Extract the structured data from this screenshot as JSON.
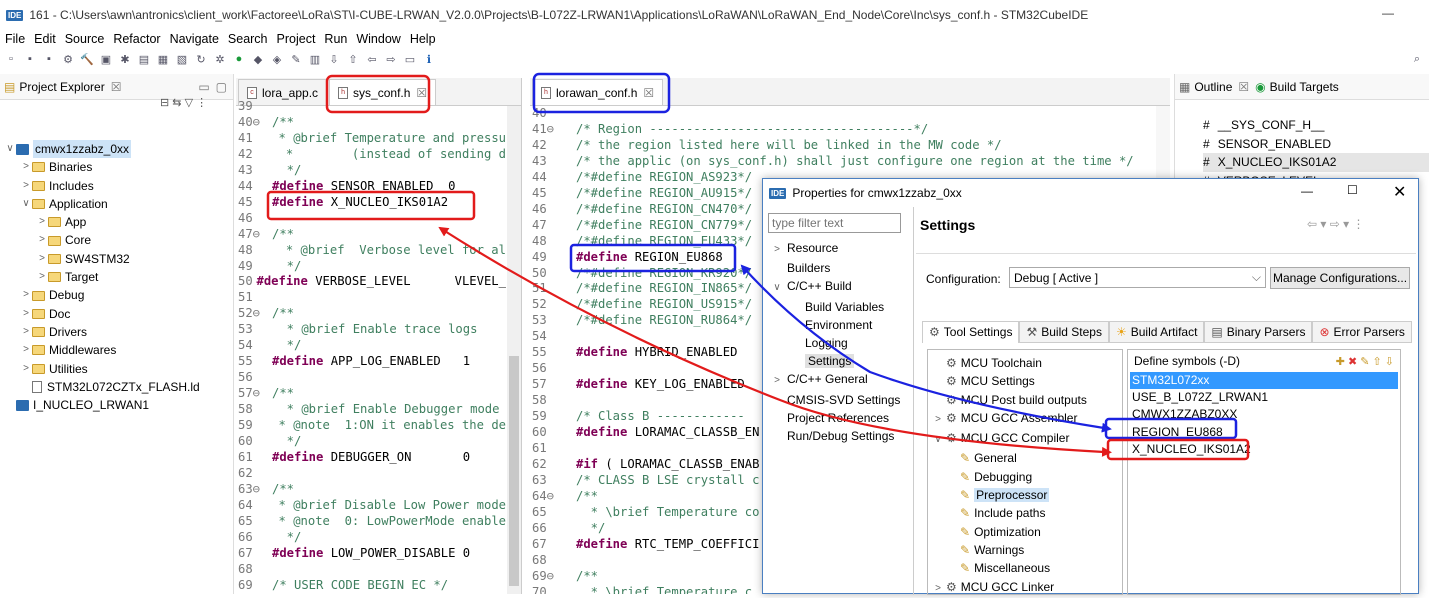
{
  "title": {
    "badge": "IDE",
    "text": "161 - C:\\Users\\awn\\antronics\\client_work\\Factoree\\LoRa\\ST\\I-CUBE-LRWAN_V2.0.0\\Projects\\B-L072Z-LRWAN1\\Applications\\LoRaWAN\\LoRaWAN_End_Node\\Core\\Inc\\sys_conf.h - STM32CubeIDE",
    "min": "—"
  },
  "menu": [
    "File",
    "Edit",
    "Source",
    "Refactor",
    "Navigate",
    "Search",
    "Project",
    "Run",
    "Window",
    "Help"
  ],
  "explorer": {
    "title": "Project Explorer",
    "items": [
      {
        "label": "cmwx1zzabz_0xx",
        "level": 0,
        "chev": "∨",
        "sel": true
      },
      {
        "label": "Binaries",
        "level": 1,
        "chev": ">"
      },
      {
        "label": "Includes",
        "level": 1,
        "chev": ">"
      },
      {
        "label": "Application",
        "level": 1,
        "chev": "∨"
      },
      {
        "label": "App",
        "level": 2,
        "chev": ">"
      },
      {
        "label": "Core",
        "level": 2,
        "chev": ">"
      },
      {
        "label": "SW4STM32",
        "level": 2,
        "chev": ">"
      },
      {
        "label": "Target",
        "level": 2,
        "chev": ">"
      },
      {
        "label": "Debug",
        "level": 1,
        "chev": ">"
      },
      {
        "label": "Doc",
        "level": 1,
        "chev": ">"
      },
      {
        "label": "Drivers",
        "level": 1,
        "chev": ">"
      },
      {
        "label": "Middlewares",
        "level": 1,
        "chev": ">"
      },
      {
        "label": "Utilities",
        "level": 1,
        "chev": ">"
      },
      {
        "label": "STM32L072CZTx_FLASH.ld",
        "level": 1,
        "chev": ""
      },
      {
        "label": "I_NUCLEO_LRWAN1",
        "level": 0,
        "chev": ""
      }
    ]
  },
  "editor1": {
    "tabs": [
      "lora_app.c",
      "sys_conf.h"
    ],
    "lines": [
      {
        "n": "39",
        "t": ""
      },
      {
        "n": "40⊖",
        "t": "/**",
        "c": "cm"
      },
      {
        "n": "41",
        "t": "  * @brief Temperature and pressu",
        "c": "cm"
      },
      {
        "n": "42",
        "t": "  *        (instead of sending d",
        "c": "cm"
      },
      {
        "n": "43",
        "t": "  */",
        "c": "cm"
      },
      {
        "n": "44",
        "k": "#define",
        "t": " SENSOR_ENABLED  0"
      },
      {
        "n": "45",
        "k": "#define",
        "t": " X_NUCLEO_IKS01A2"
      },
      {
        "n": "46",
        "t": ""
      },
      {
        "n": "47⊖",
        "t": "/**",
        "c": "cm"
      },
      {
        "n": "48",
        "t": "  * @brief  Verbose level for al",
        "c": "cm"
      },
      {
        "n": "49",
        "t": "  */",
        "c": "cm"
      },
      {
        "n": "50",
        "k": "#define",
        "t": " VERBOSE_LEVEL      VLEVEL_"
      },
      {
        "n": "51",
        "t": ""
      },
      {
        "n": "52⊖",
        "t": "/**",
        "c": "cm"
      },
      {
        "n": "53",
        "t": "  * @brief Enable trace logs",
        "c": "cm"
      },
      {
        "n": "54",
        "t": "  */",
        "c": "cm"
      },
      {
        "n": "55",
        "k": "#define",
        "t": " APP_LOG_ENABLED   1"
      },
      {
        "n": "56",
        "t": ""
      },
      {
        "n": "57⊖",
        "t": "/**",
        "c": "cm"
      },
      {
        "n": "58",
        "t": "  * @brief Enable Debugger mode",
        "c": "cm"
      },
      {
        "n": "59",
        "t": "  * @note  1:ON it enables the de",
        "c": "cm"
      },
      {
        "n": "60",
        "t": "  */",
        "c": "cm"
      },
      {
        "n": "61",
        "k": "#define",
        "t": " DEBUGGER_ON       0"
      },
      {
        "n": "62",
        "t": ""
      },
      {
        "n": "63⊖",
        "t": "/**",
        "c": "cm"
      },
      {
        "n": "64",
        "t": "  * @brief Disable Low Power mode",
        "c": "cm"
      },
      {
        "n": "65",
        "t": "  * @note  0: LowPowerMode enable",
        "c": "cm"
      },
      {
        "n": "66",
        "t": "  */",
        "c": "cm"
      },
      {
        "n": "67",
        "k": "#define",
        "t": " LOW_POWER_DISABLE 0"
      },
      {
        "n": "68",
        "t": ""
      },
      {
        "n": "69",
        "t": "/* USER CODE BEGIN EC */",
        "c": "cm"
      }
    ]
  },
  "editor2": {
    "tab": "lorawan_conf.h",
    "lines": [
      {
        "n": "40",
        "t": ""
      },
      {
        "n": "41⊖",
        "t": "/* Region ------------------------------------*/",
        "c": "cm"
      },
      {
        "n": "42",
        "t": "/* the region listed here will be linked in the MW code */",
        "c": "cm"
      },
      {
        "n": "43",
        "t": "/* the applic (on sys_conf.h) shall just configure one region at the time */",
        "c": "cm"
      },
      {
        "n": "44",
        "t": "/*#define REGION_AS923*/",
        "c": "cm"
      },
      {
        "n": "45",
        "t": "/*#define REGION_AU915*/",
        "c": "cm"
      },
      {
        "n": "46",
        "t": "/*#define REGION_CN470*/",
        "c": "cm"
      },
      {
        "n": "47",
        "t": "/*#define REGION_CN779*/",
        "c": "cm"
      },
      {
        "n": "48",
        "t": "/*#define REGION_EU433*/",
        "c": "cm"
      },
      {
        "n": "49",
        "k": "#define",
        "t": " REGION_EU868"
      },
      {
        "n": "50",
        "t": "/*#define REGION_KR920*/",
        "c": "cm"
      },
      {
        "n": "51",
        "t": "/*#define REGION_IN865*/",
        "c": "cm"
      },
      {
        "n": "52",
        "t": "/*#define REGION_US915*/",
        "c": "cm"
      },
      {
        "n": "53",
        "t": "/*#define REGION_RU864*/",
        "c": "cm"
      },
      {
        "n": "54",
        "t": ""
      },
      {
        "n": "55",
        "k": "#define",
        "t": " HYBRID_ENABLED"
      },
      {
        "n": "56",
        "t": ""
      },
      {
        "n": "57",
        "k": "#define",
        "t": " KEY_LOG_ENABLED"
      },
      {
        "n": "58",
        "t": ""
      },
      {
        "n": "59",
        "t": "/* Class B ------------",
        "c": "cm"
      },
      {
        "n": "60",
        "k": "#define",
        "t": " LORAMAC_CLASSB_EN"
      },
      {
        "n": "61",
        "t": ""
      },
      {
        "n": "62",
        "k": "#if",
        "t": " ( LORAMAC_CLASSB_ENAB"
      },
      {
        "n": "63",
        "t": "/* CLASS B LSE crystall c",
        "c": "cm"
      },
      {
        "n": "64⊖",
        "t": "/**",
        "c": "cm"
      },
      {
        "n": "65",
        "t": "  * \\brief Temperature co",
        "c": "cm"
      },
      {
        "n": "66",
        "t": "  */",
        "c": "cm"
      },
      {
        "n": "67",
        "k": "#define",
        "t": " RTC_TEMP_COEFFICI"
      },
      {
        "n": "68",
        "t": ""
      },
      {
        "n": "69⊖",
        "t": "/**",
        "c": "cm"
      },
      {
        "n": "70",
        "t": "  * \\brief Temperature c",
        "c": "cm"
      }
    ]
  },
  "outline": {
    "tab1": "Outline",
    "tab2": "Build Targets",
    "items": [
      "__SYS_CONF_H__",
      "SENSOR_ENABLED",
      "X_NUCLEO_IKS01A2",
      "VERBOSE_LEVEL"
    ]
  },
  "dialog": {
    "title": "Properties for cmwx1zzabz_0xx",
    "filter_placeholder": "type filter text",
    "nav": [
      {
        "label": "Resource",
        "lvl": 0,
        "chev": ">"
      },
      {
        "label": "Builders",
        "lvl": 0,
        "chev": ""
      },
      {
        "label": "C/C++ Build",
        "lvl": 0,
        "chev": "∨"
      },
      {
        "label": "Build Variables",
        "lvl": 1,
        "chev": ""
      },
      {
        "label": "Environment",
        "lvl": 1,
        "chev": ""
      },
      {
        "label": "Logging",
        "lvl": 1,
        "chev": ""
      },
      {
        "label": "Settings",
        "lvl": 1,
        "chev": "",
        "sel": true
      },
      {
        "label": "C/C++ General",
        "lvl": 0,
        "chev": ">"
      },
      {
        "label": "CMSIS-SVD Settings",
        "lvl": 0,
        "chev": ""
      },
      {
        "label": "Project References",
        "lvl": 0,
        "chev": ""
      },
      {
        "label": "Run/Debug Settings",
        "lvl": 0,
        "chev": ""
      }
    ],
    "heading": "Settings",
    "config_label": "Configuration:",
    "config_value": "Debug  [ Active ]",
    "manage_btn": "Manage Configurations...",
    "tabs": [
      "Tool Settings",
      "Build Steps",
      "Build Artifact",
      "Binary Parsers",
      "Error Parsers"
    ],
    "tool_tree": [
      {
        "label": "MCU Toolchain",
        "lvl": 0,
        "chev": ""
      },
      {
        "label": "MCU Settings",
        "lvl": 0,
        "chev": ""
      },
      {
        "label": "MCU Post build outputs",
        "lvl": 0,
        "chev": ""
      },
      {
        "label": "MCU GCC Assembler",
        "lvl": 0,
        "chev": ">"
      },
      {
        "label": "MCU GCC Compiler",
        "lvl": 0,
        "chev": "∨"
      },
      {
        "label": "General",
        "lvl": 1,
        "chev": ""
      },
      {
        "label": "Debugging",
        "lvl": 1,
        "chev": ""
      },
      {
        "label": "Preprocessor",
        "lvl": 1,
        "chev": "",
        "sel": true
      },
      {
        "label": "Include paths",
        "lvl": 1,
        "chev": ""
      },
      {
        "label": "Optimization",
        "lvl": 1,
        "chev": ""
      },
      {
        "label": "Warnings",
        "lvl": 1,
        "chev": ""
      },
      {
        "label": "Miscellaneous",
        "lvl": 1,
        "chev": ""
      },
      {
        "label": "MCU GCC Linker",
        "lvl": 0,
        "chev": ">"
      }
    ],
    "symbols_header": "Define symbols (-D)",
    "symbols": [
      "STM32L072xx",
      "USE_B_L072Z_LRWAN1",
      "CMWX1ZZABZ0XX",
      "REGION_EU868",
      "X_NUCLEO_IKS01A2"
    ]
  },
  "colors": {
    "red": "#e21b1b",
    "blue": "#1b22e0"
  }
}
